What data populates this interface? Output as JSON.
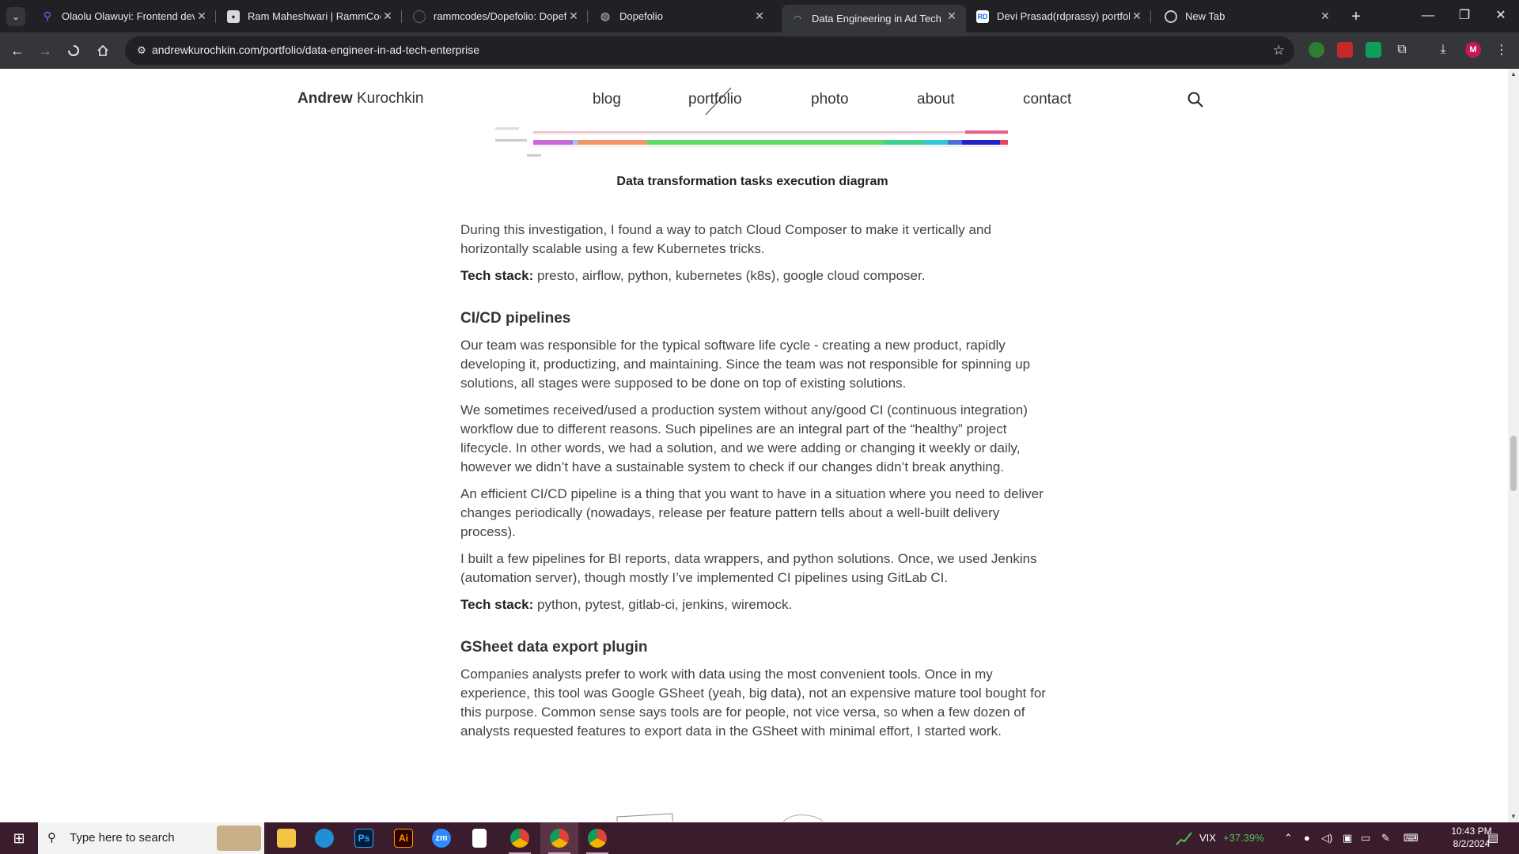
{
  "browser": {
    "tabs": [
      {
        "title": "Olaolu Olawuyi: Frontend developer",
        "favicon": "location-pin-icon",
        "active": false
      },
      {
        "title": "Ram Maheshwari | RammCodes",
        "favicon": "person-photo-icon",
        "active": false
      },
      {
        "title": "rammcodes/Dopefolio: Dopefolio",
        "favicon": "github-icon",
        "active": false
      },
      {
        "title": "Dopefolio",
        "favicon": "globe-icon",
        "active": false
      },
      {
        "title": "Data Engineering in Ad Tech enterprise",
        "favicon": "loading-icon",
        "active": true
      },
      {
        "title": "Devi Prasad(rdprassy) portfolio",
        "favicon": "rd-logo-icon",
        "active": false
      },
      {
        "title": "New Tab",
        "favicon": "chrome-icon",
        "active": false
      }
    ],
    "url": "andrewkurochkin.com/portfolio/data-engineer-in-ad-tech-enterprise",
    "profile_initial": "M",
    "favicon_rd_text": "RD"
  },
  "site": {
    "logo_first": "Andrew",
    "logo_last": "Kurochkin",
    "nav": [
      "blog",
      "portfolio",
      "photo",
      "about",
      "contact"
    ]
  },
  "article": {
    "diagram_caption": "Data transformation tasks execution diagram",
    "p1": "During this investigation, I found a way to patch Cloud Composer to make it vertically and horizontally scalable using a few Kubernetes tricks.",
    "tech_label": "Tech stack:",
    "tech1": "presto, airflow, python, kubernetes (k8s), google cloud composer.",
    "h_cicd": "CI/CD pipelines",
    "p2": "Our team was responsible for the typical software life cycle - creating a new product, rapidly developing it, productizing, and maintaining. Since the team was not responsible for spinning up solutions, all stages were supposed to be done on top of existing solutions.",
    "p3": "We sometimes received/used a production system without any/good CI (continuous integration) workflow due to different reasons. Such pipelines are an integral part of the “healthy” project lifecycle. In other words, we had a solution, and we were adding or changing it weekly or daily, however we didn’t have a sustainable system to check if our changes didn’t break anything.",
    "p4": "An efficient CI/CD pipeline is a thing that you want to have in a situation where you need to deliver changes periodically (nowadays, release per feature pattern tells about a well-built delivery process).",
    "p5": "I built a few pipelines for BI reports, data wrappers, and python solutions. Once, we used Jenkins (automation server), though mostly I’ve implemented CI pipelines using GitLab CI.",
    "tech2": "python, pytest, gitlab-ci, jenkins, wiremock.",
    "h_gsheet": "GSheet data export plugin",
    "p6": "Companies analysts prefer to work with data using the most convenient tools. Once in my experience, this tool was Google GSheet (yeah, big data), not an expensive mature tool bought for this purpose. Common sense says tools are for people, not vice versa, so when a few dozen of analysts requested features to export data in the GSheet with minimal effort, I started work."
  },
  "taskbar": {
    "search_placeholder": "Type here to search",
    "apps": [
      "file-explorer-icon",
      "edge-icon",
      "photoshop-icon",
      "illustrator-icon",
      "zoom-icon",
      "notepad-icon",
      "chrome-icon",
      "chrome-profile-icon",
      "chrome-active-icon"
    ],
    "ps_text": "Ps",
    "ai_text": "Ai",
    "zoom_text": "zm",
    "stock_name": "VIX",
    "stock_change": "+37.39%",
    "time": "10:43 PM",
    "date": "8/2/2024"
  },
  "colors": {
    "tab_bg": "#202124",
    "toolbar_bg": "#35363a",
    "taskbar_bg": "#3b1c2c",
    "stock_green": "#4cc25a"
  }
}
